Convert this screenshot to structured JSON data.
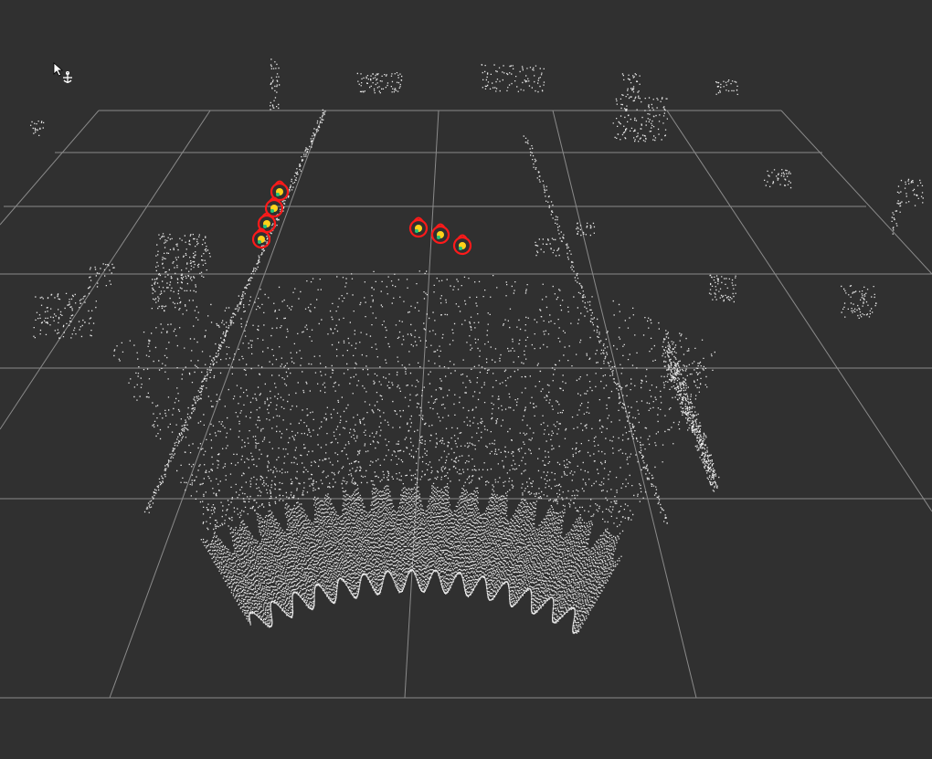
{
  "viewer": {
    "type": "3d-point-cloud-view",
    "background_color": "#303030",
    "grid_color": "#8a8a8a",
    "point_color": "#e8e8e8",
    "detection_color": "#ff1a1a",
    "detection_highlight_color": "#ffd21a",
    "detection_accent_color": "#22c47a",
    "cursor_icon": "move-camera-cursor-icon"
  },
  "detections": [
    {
      "label": "",
      "kind": "pole-cluster"
    },
    {
      "label": "",
      "kind": "object-cluster"
    },
    {
      "label": "",
      "kind": "object-cluster"
    },
    {
      "label": "",
      "kind": "object-cluster"
    }
  ]
}
